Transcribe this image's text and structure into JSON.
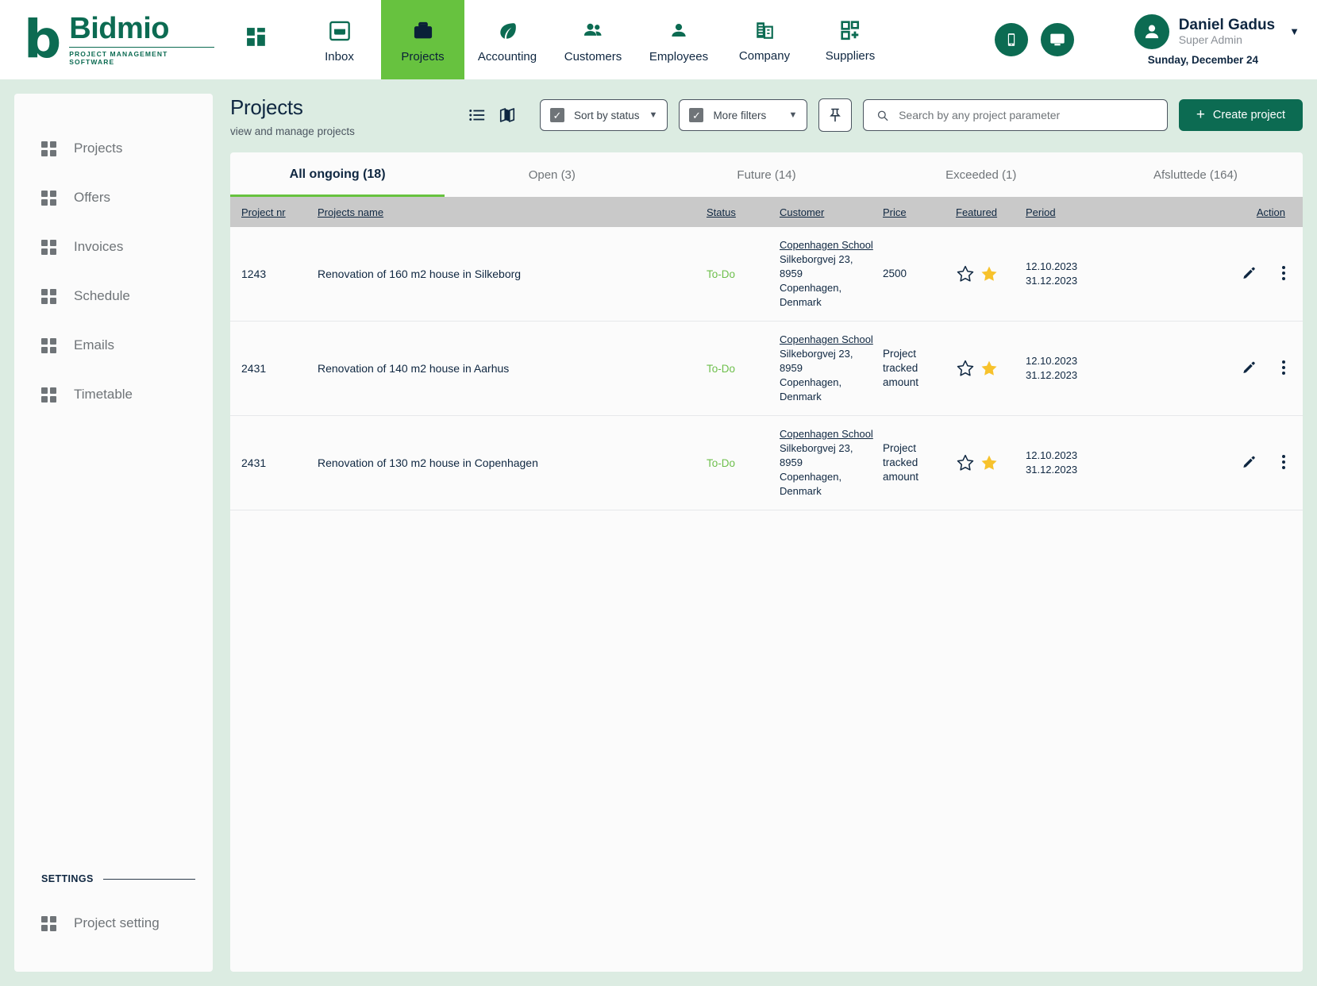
{
  "brand": {
    "logo_glyph": "b",
    "name": "Bidmio",
    "tagline": "PROJECT MANAGEMENT SOFTWARE"
  },
  "topnav": {
    "items": [
      {
        "label": "",
        "icon": "dashboard-grid-icon"
      },
      {
        "label": "Inbox",
        "icon": "inbox-icon"
      },
      {
        "label": "Projects",
        "icon": "briefcase-icon"
      },
      {
        "label": "Accounting",
        "icon": "leaf-icon"
      },
      {
        "label": "Customers",
        "icon": "people-icon"
      },
      {
        "label": "Employees",
        "icon": "person-icon"
      },
      {
        "label": "Company",
        "icon": "building-icon"
      },
      {
        "label": "Suppliers",
        "icon": "grid-plus-icon"
      }
    ],
    "active": "Projects"
  },
  "quick_actions": [
    {
      "icon": "mobile-phone-icon"
    },
    {
      "icon": "desktop-monitor-icon"
    }
  ],
  "profile": {
    "name": "Daniel Gadus",
    "role": "Super Admin",
    "date": "Sunday, December 24",
    "caret": "▼"
  },
  "sidebar": {
    "items": [
      {
        "label": "Projects"
      },
      {
        "label": "Offers"
      },
      {
        "label": "Invoices"
      },
      {
        "label": "Schedule"
      },
      {
        "label": "Emails"
      },
      {
        "label": "Timetable"
      }
    ],
    "settings_title": "SETTINGS",
    "settings_items": [
      {
        "label": "Project setting"
      }
    ]
  },
  "header": {
    "title": "Projects",
    "subtitle": "view and manage projects"
  },
  "toolbar": {
    "list_view_icon": "list-view-icon",
    "map_view_icon": "map-view-icon",
    "sort_label": "Sort by status",
    "filters_label": "More filters",
    "pin_icon": "pin-icon",
    "search_placeholder": "Search by any project parameter",
    "search_value": "",
    "create_label": "Create project",
    "create_plus": "+"
  },
  "tabs": [
    {
      "label": "All ongoing (18)",
      "active": true
    },
    {
      "label": "Open (3)",
      "active": false
    },
    {
      "label": "Future (14)",
      "active": false
    },
    {
      "label": "Exceeded (1)",
      "active": false
    },
    {
      "label": "Afsluttede (164)",
      "active": false
    }
  ],
  "table": {
    "columns": [
      {
        "key": "project_nr",
        "label": "Project nr"
      },
      {
        "key": "projects_name",
        "label": "Projects name"
      },
      {
        "key": "status",
        "label": "Status"
      },
      {
        "key": "customer",
        "label": "Customer "
      },
      {
        "key": "price",
        "label": "Price"
      },
      {
        "key": "featured",
        "label": "Featured"
      },
      {
        "key": "period",
        "label": "Period"
      },
      {
        "key": "action",
        "label": "Action"
      }
    ],
    "rows": [
      {
        "project_nr": "1243",
        "projects_name": "Renovation of 160 m2  house in Silkeborg",
        "status": "To-Do",
        "customer_name": "Copenhagen School",
        "customer_address": "Silkeborgvej 23, 8959",
        "customer_city": "Copenhagen, Denmark",
        "price": "2500",
        "featured_outline": "★",
        "featured_filled": "★",
        "period_start": "12.10.2023",
        "period_end": "31.12.2023"
      },
      {
        "project_nr": "2431",
        "projects_name": "Renovation of 140 m2  house in Aarhus",
        "status": "To-Do",
        "customer_name": "Copenhagen School",
        "customer_address": "Silkeborgvej 23, 8959",
        "customer_city": "Copenhagen, Denmark",
        "price": "Project tracked amount",
        "featured_outline": "★",
        "featured_filled": "★",
        "period_start": "12.10.2023",
        "period_end": "31.12.2023"
      },
      {
        "project_nr": "2431",
        "projects_name": "Renovation of 130 m2  house in Copenhagen",
        "status": "To-Do",
        "customer_name": "Copenhagen School",
        "customer_address": "Silkeborgvej 23, 8959",
        "customer_city": "Copenhagen, Denmark",
        "price": "Project tracked amount",
        "featured_outline": "★",
        "featured_filled": "★",
        "period_start": "12.10.2023",
        "period_end": "31.12.2023"
      }
    ]
  },
  "colors": {
    "brand_green": "#0c6b52",
    "accent_green": "#67c23f",
    "status_green": "#6dbf4b",
    "star_gold": "#f7c22c",
    "page_bg": "#dcece2",
    "header_row": "#c9c9c9"
  }
}
